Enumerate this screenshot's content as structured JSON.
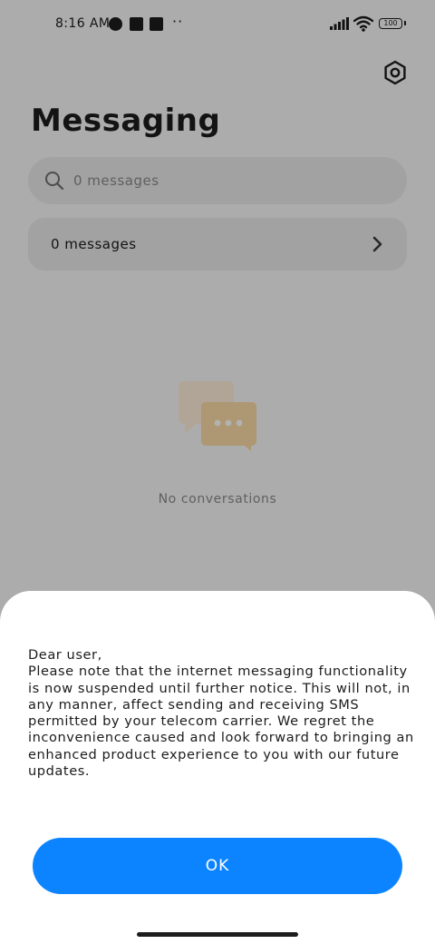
{
  "status_bar": {
    "time": "8:16 AM",
    "battery_level": "100",
    "icons": [
      "notification-icon",
      "notification-icon",
      "upload-icon",
      "more-dots-icon",
      "signal-icon",
      "wifi-icon",
      "battery-icon"
    ]
  },
  "header": {
    "title": "Messaging",
    "settings_icon": "gear-icon"
  },
  "search": {
    "placeholder": "0 messages"
  },
  "messages_row": {
    "label": "0 messages"
  },
  "empty_state": {
    "icon": "chat-bubbles-icon",
    "text": "No conversations"
  },
  "dialog": {
    "message": "Dear user,\nPlease note that the internet messaging functionality is now suspended until further notice. This will not, in any manner, affect sending and receiving SMS permitted by your telecom carrier. We regret the inconvenience caused and look forward to bringing an enhanced product experience to you with our future updates.",
    "ok_label": "OK"
  },
  "colors": {
    "accent": "#0d84ff",
    "background": "#f6f6f6",
    "dialog_background": "#ffffff",
    "scrim": "#000000"
  }
}
